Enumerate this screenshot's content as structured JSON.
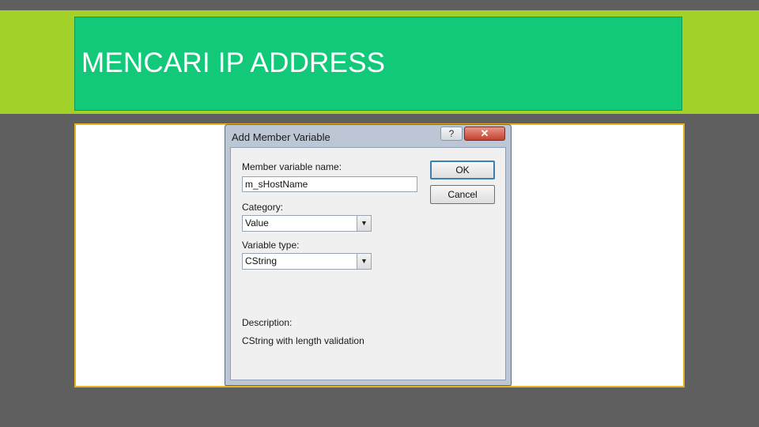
{
  "slide": {
    "title": "MENCARI IP ADDRESS"
  },
  "dialog": {
    "title": "Add Member Variable",
    "help_glyph": "?",
    "close_glyph": "✕",
    "member_name_label": "Member variable name:",
    "member_name_value": "m_sHostName",
    "category_label": "Category:",
    "category_value": "Value",
    "variable_type_label": "Variable type:",
    "variable_type_value": "CString",
    "description_label": "Description:",
    "description_text": "CString with length validation",
    "ok_label": "OK",
    "cancel_label": "Cancel",
    "dropdown_glyph": "▼"
  },
  "colors": {
    "top_band": "#a2d12a",
    "title_box": "#12c97a",
    "frame_border": "#e6b422",
    "background": "#5f5f5f"
  }
}
